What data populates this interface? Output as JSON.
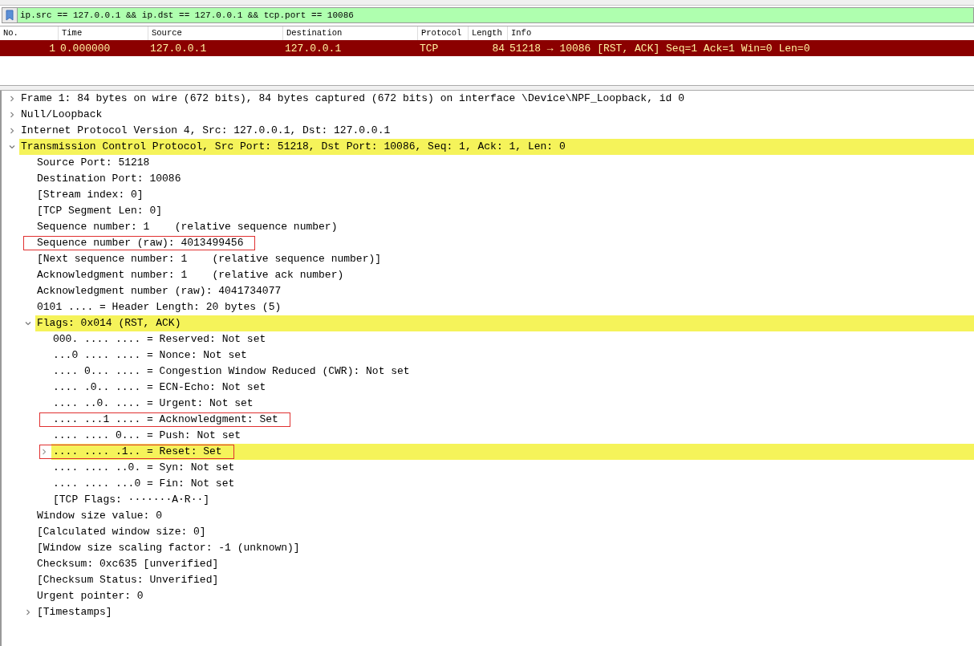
{
  "filter": {
    "value": "ip.src == 127.0.0.1 && ip.dst == 127.0.0.1 && tcp.port == 10086"
  },
  "packet_list": {
    "columns": [
      "No.",
      "Time",
      "Source",
      "Destination",
      "Protocol",
      "Length",
      "Info"
    ],
    "rows": [
      {
        "no": "1",
        "time": "0.000000",
        "source": "127.0.0.1",
        "destination": "127.0.0.1",
        "protocol": "TCP",
        "length": "84",
        "info": "51218 → 10086 [RST, ACK] Seq=1 Ack=1 Win=0 Len=0",
        "selected": true
      }
    ]
  },
  "tree": [
    {
      "kind": "branch",
      "expanded": false,
      "label": "Frame 1: 84 bytes on wire (672 bits), 84 bytes captured (672 bits) on interface \\Device\\NPF_Loopback, id 0",
      "highlighted": false,
      "boxed": false
    },
    {
      "kind": "branch",
      "expanded": false,
      "label": "Null/Loopback",
      "highlighted": false,
      "boxed": false
    },
    {
      "kind": "branch",
      "expanded": false,
      "label": "Internet Protocol Version 4, Src: 127.0.0.1, Dst: 127.0.0.1",
      "highlighted": false,
      "boxed": false
    },
    {
      "kind": "branch",
      "expanded": true,
      "label": "Transmission Control Protocol, Src Port: 51218, Dst Port: 10086, Seq: 1, Ack: 1, Len: 0",
      "highlighted": true,
      "boxed": false,
      "children": [
        {
          "kind": "leaf",
          "label": "Source Port: 51218",
          "highlighted": false,
          "boxed": false
        },
        {
          "kind": "leaf",
          "label": "Destination Port: 10086",
          "highlighted": false,
          "boxed": false
        },
        {
          "kind": "leaf",
          "label": "[Stream index: 0]",
          "highlighted": false,
          "boxed": false
        },
        {
          "kind": "leaf",
          "label": "[TCP Segment Len: 0]",
          "highlighted": false,
          "boxed": false
        },
        {
          "kind": "leaf",
          "label": "Sequence number: 1    (relative sequence number)",
          "highlighted": false,
          "boxed": false
        },
        {
          "kind": "leaf",
          "label": "Sequence number (raw): 4013499456",
          "highlighted": false,
          "boxed": true
        },
        {
          "kind": "leaf",
          "label": "[Next sequence number: 1    (relative sequence number)]",
          "highlighted": false,
          "boxed": false
        },
        {
          "kind": "leaf",
          "label": "Acknowledgment number: 1    (relative ack number)",
          "highlighted": false,
          "boxed": false
        },
        {
          "kind": "leaf",
          "label": "Acknowledgment number (raw): 4041734077",
          "highlighted": false,
          "boxed": false
        },
        {
          "kind": "leaf",
          "label": "0101 .... = Header Length: 20 bytes (5)",
          "highlighted": false,
          "boxed": false
        },
        {
          "kind": "branch",
          "expanded": true,
          "label": "Flags: 0x014 (RST, ACK)",
          "highlighted": true,
          "boxed": false,
          "children": [
            {
              "kind": "leaf",
              "label": "000. .... .... = Reserved: Not set",
              "highlighted": false,
              "boxed": false
            },
            {
              "kind": "leaf",
              "label": "...0 .... .... = Nonce: Not set",
              "highlighted": false,
              "boxed": false
            },
            {
              "kind": "leaf",
              "label": ".... 0... .... = Congestion Window Reduced (CWR): Not set",
              "highlighted": false,
              "boxed": false
            },
            {
              "kind": "leaf",
              "label": ".... .0.. .... = ECN-Echo: Not set",
              "highlighted": false,
              "boxed": false
            },
            {
              "kind": "leaf",
              "label": ".... ..0. .... = Urgent: Not set",
              "highlighted": false,
              "boxed": false
            },
            {
              "kind": "leaf",
              "label": ".... ...1 .... = Acknowledgment: Set",
              "highlighted": false,
              "boxed": true
            },
            {
              "kind": "leaf",
              "label": ".... .... 0... = Push: Not set",
              "highlighted": false,
              "boxed": false
            },
            {
              "kind": "branch",
              "expanded": false,
              "label": ".... .... .1.. = Reset: Set",
              "highlighted": true,
              "boxed": true
            },
            {
              "kind": "leaf",
              "label": ".... .... ..0. = Syn: Not set",
              "highlighted": false,
              "boxed": false
            },
            {
              "kind": "leaf",
              "label": ".... .... ...0 = Fin: Not set",
              "highlighted": false,
              "boxed": false
            },
            {
              "kind": "leaf",
              "label": "[TCP Flags: ·······A·R··]",
              "highlighted": false,
              "boxed": false
            }
          ]
        },
        {
          "kind": "leaf",
          "label": "Window size value: 0",
          "highlighted": false,
          "boxed": false
        },
        {
          "kind": "leaf",
          "label": "[Calculated window size: 0]",
          "highlighted": false,
          "boxed": false
        },
        {
          "kind": "leaf",
          "label": "[Window size scaling factor: -1 (unknown)]",
          "highlighted": false,
          "boxed": false
        },
        {
          "kind": "leaf",
          "label": "Checksum: 0xc635 [unverified]",
          "highlighted": false,
          "boxed": false
        },
        {
          "kind": "leaf",
          "label": "[Checksum Status: Unverified]",
          "highlighted": false,
          "boxed": false
        },
        {
          "kind": "leaf",
          "label": "Urgent pointer: 0",
          "highlighted": false,
          "boxed": false
        },
        {
          "kind": "branch",
          "expanded": false,
          "label": "[Timestamps]",
          "highlighted": false,
          "boxed": false
        }
      ]
    }
  ]
}
